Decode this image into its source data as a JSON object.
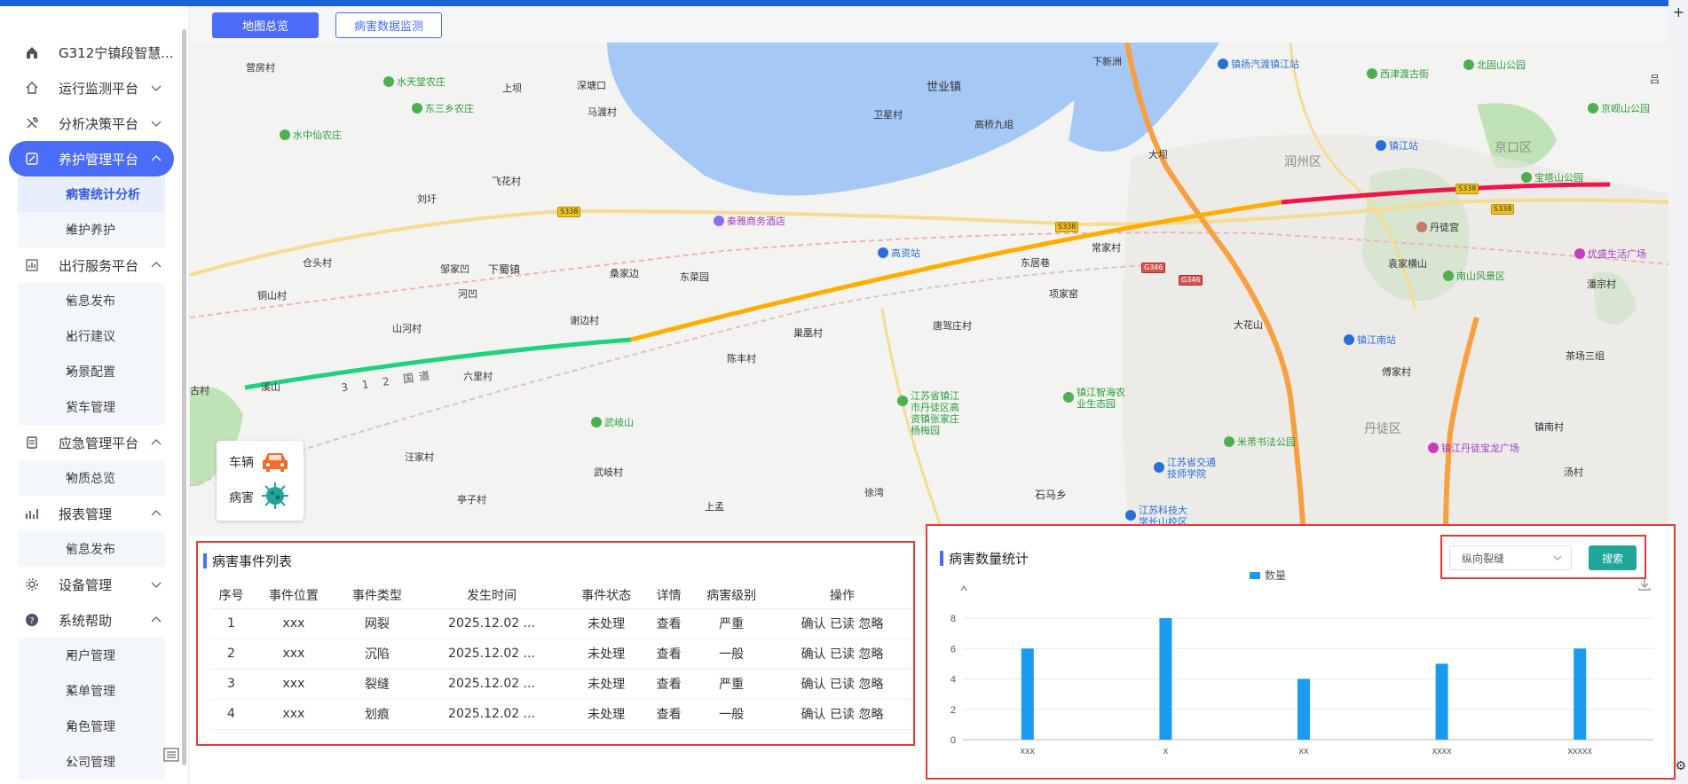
{
  "app": {
    "title": "G312宁镇段智慧..."
  },
  "sidebar": {
    "items": [
      {
        "label": "G312宁镇段智慧...",
        "icon": "home-icon"
      },
      {
        "label": "运行监测平台",
        "icon": "house-icon"
      },
      {
        "label": "分析决策平台",
        "icon": "tools-icon"
      },
      {
        "label": "养护管理平台",
        "icon": "edit-icon",
        "active": true
      },
      {
        "sub": "病害统计分析",
        "active": true
      },
      {
        "sub": "维护养护"
      },
      {
        "label": "出行服务平台",
        "icon": "chart-icon"
      },
      {
        "sub": "信息发布"
      },
      {
        "sub": "出行建议"
      },
      {
        "sub": "场景配置"
      },
      {
        "sub": "货车管理"
      },
      {
        "label": "应急管理平台",
        "icon": "clipboard-icon"
      },
      {
        "sub": "物质总览"
      },
      {
        "label": "报表管理",
        "icon": "report-icon"
      },
      {
        "sub": "信息发布"
      },
      {
        "label": "设备管理",
        "icon": "gear-icon"
      },
      {
        "label": "系统帮助",
        "icon": "help-icon"
      },
      {
        "sub": "用户管理"
      },
      {
        "sub": "菜单管理"
      },
      {
        "sub": "角色管理"
      },
      {
        "sub": "公司管理"
      }
    ]
  },
  "tabs": [
    {
      "label": "地图总览",
      "active": true
    },
    {
      "label": "病害数据监测",
      "active": false
    }
  ],
  "map": {
    "legend": [
      {
        "label": "车辆",
        "icon": "car-icon",
        "color": "#f26b2a"
      },
      {
        "label": "病害",
        "icon": "virus-icon",
        "color": "#1fa59a"
      }
    ],
    "route_colors": {
      "good": "#1ed37e",
      "warn": "#ffad00",
      "bad": "#f0154a",
      "side": "#f8a040"
    },
    "labels": {
      "l1": "营房村",
      "l2": "水天堂农庄",
      "l3": "上坝",
      "l4": "深塘口",
      "l5": "世业镇",
      "l6": "东三乡农庄",
      "l7": "马渡村",
      "l8": "卫星村",
      "l9": "高桥九组",
      "l10": "水中仙农庄",
      "l11": "飞花村",
      "l12": "刘圩",
      "l13": "秦雅商务酒店",
      "l14": "仓头村",
      "l15": "邹家凹",
      "l16": "下蜀镇",
      "l17": "桑家边",
      "l18": "东菜园",
      "l19": "高资站",
      "l20": "东居巷",
      "l21": "铜山村",
      "l22": "河凹",
      "l23": "项家窑",
      "l24": "山河村",
      "l25": "谢边村",
      "l26": "巢凰村",
      "l27": "唐驾庄村",
      "l28": "陈丰村",
      "l29": "六里村",
      "l30": "武岐山",
      "l31": "江苏省镇江市丹徒区高资镇张家庄杨梅园",
      "l32": "镇江智海农业生态园",
      "l33": "汪家村",
      "l34": "武岐村",
      "l35": "亭子村",
      "l36": "上孟",
      "l37": "徐湾",
      "l38": "石马乡",
      "l39": "江苏省交通技师学院",
      "l40": "江苏科技大学长山校区",
      "l41": "下新洲",
      "l42": "镇扬汽渡镇江站",
      "l43": "西津渡古街",
      "l44": "北固山公园",
      "l45": "镇江站",
      "l46": "京岘山公园",
      "l47": "京口区",
      "l48": "润州区",
      "l49": "宝塔山公园",
      "l50": "大坝",
      "l51": "丹徒宫",
      "l52": "优盛生活广场",
      "l53": "袁家横山",
      "l54": "南山风景区",
      "l55": "潘宗村",
      "l56": "大花山",
      "l57": "镇江南站",
      "l58": "茶场三组",
      "l59": "傅家村",
      "l60": "丹徒区",
      "l61": "镇南村",
      "l62": "米芾书法公园",
      "l63": "镇江丹徒宝龙广场",
      "l64": "汤村",
      "l65": "吕",
      "l66": "古村",
      "l67": "溪山",
      "l68": "3 1 2 国道",
      "l69": "常家村"
    },
    "shields": [
      "S338",
      "S338",
      "S338",
      "S338",
      "G346",
      "G346"
    ]
  },
  "events": {
    "title": "病害事件列表",
    "columns": [
      "序号",
      "事件位置",
      "事件类型",
      "发生时间",
      "事件状态",
      "详情",
      "病害级别",
      "操作"
    ],
    "rows": [
      {
        "no": "1",
        "loc": "xxx",
        "type": "网裂",
        "time": "2025.12.02 ...",
        "status": "未处理",
        "detail": "查看",
        "level": "严重",
        "level_color": "red",
        "ops": "确认 已读 忽略"
      },
      {
        "no": "2",
        "loc": "xxx",
        "type": "沉陷",
        "time": "2025.12.02 ...",
        "status": "未处理",
        "detail": "查看",
        "level": "一般",
        "level_color": "orange",
        "ops": "确认 已读 忽略"
      },
      {
        "no": "3",
        "loc": "xxx",
        "type": "裂缝",
        "time": "2025.12.02 ...",
        "status": "未处理",
        "detail": "查看",
        "level": "严重",
        "level_color": "red",
        "ops": "确认 已读 忽略"
      },
      {
        "no": "4",
        "loc": "xxx",
        "type": "划痕",
        "time": "2025.12.02 ...",
        "status": "未处理",
        "detail": "查看",
        "level": "一般",
        "level_color": "orange",
        "ops": "确认 已读 忽略"
      }
    ]
  },
  "stats": {
    "title": "病害数量统计",
    "select_value": "纵向裂缝",
    "search_label": "搜索"
  },
  "chart_data": {
    "type": "bar",
    "categories": [
      "xxx",
      "x",
      "xx",
      "xxxx",
      "xxxxx"
    ],
    "series": [
      {
        "name": "数量",
        "values": [
          6,
          8,
          4,
          5,
          6
        ],
        "color": "#1a9bf0"
      }
    ],
    "yticks": [
      "0",
      "2",
      "4",
      "6",
      "8"
    ],
    "ylim": [
      0,
      8
    ],
    "grid": true,
    "legend_position": "top-center"
  }
}
